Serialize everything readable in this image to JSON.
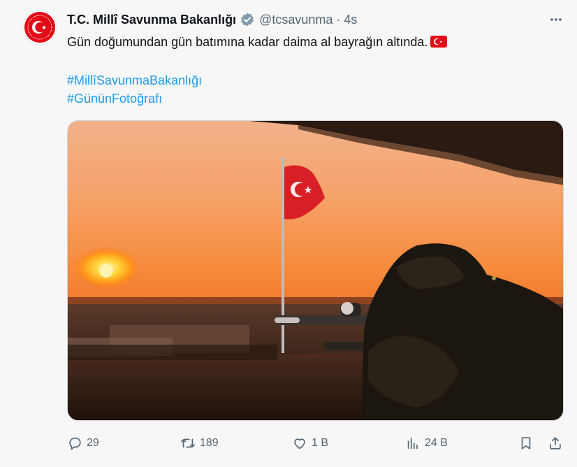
{
  "author": {
    "name": "T.C. Millî Savunma Bakanlığı",
    "handle": "@tcsavunma",
    "separator": "·",
    "time": "4s",
    "avatar_icon": "msb-emblem-icon",
    "verified_icon": "verified-badge-icon",
    "verified_color": "#829aab"
  },
  "tweet": {
    "text": "Gün doğumundan gün batımına kadar daima al bayrağın altında.",
    "emoji": "turkey-flag-icon",
    "hashtags": [
      "#MillîSavunmaBakanlığı",
      "#GününFotoğrafı"
    ],
    "link_color": "#1d9bf0"
  },
  "media": {
    "description_icon": "photo-sunset-soldier-flag",
    "flag_color": "#d81f26"
  },
  "actions": {
    "reply_count": "29",
    "retweet_count": "189",
    "like_count": "1 B",
    "views_count": "24 B"
  }
}
